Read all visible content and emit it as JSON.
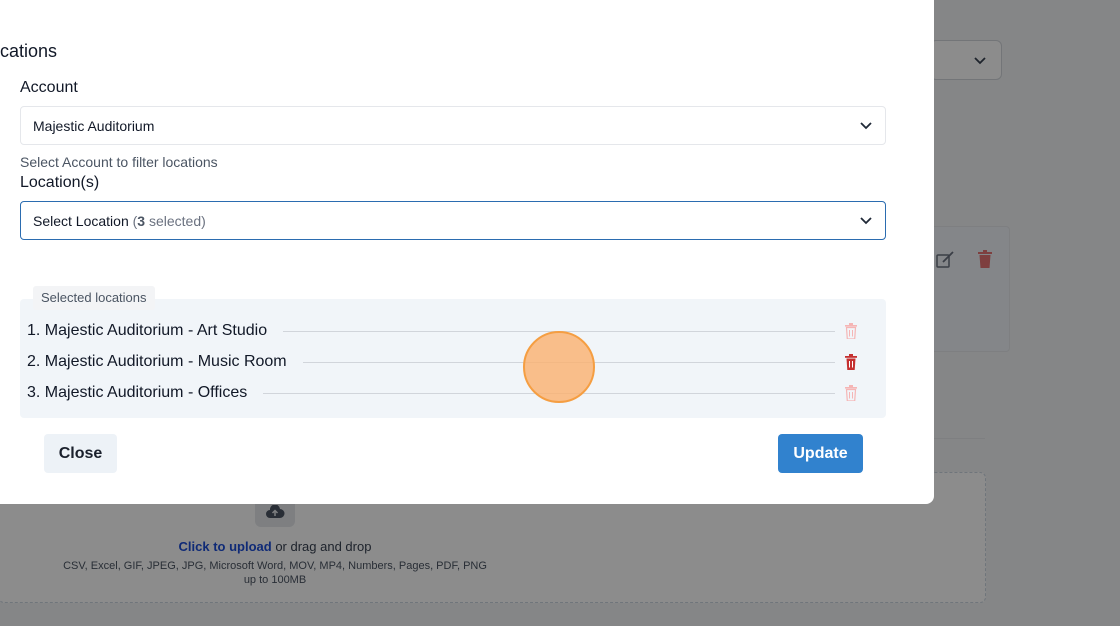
{
  "modal": {
    "title": "cations",
    "account": {
      "label": "Account",
      "value": "Majestic Auditorium",
      "help": "Select Account to filter locations"
    },
    "locations": {
      "label": "Location(s)",
      "placeholder": "Select Location",
      "count_open": "(",
      "count": "3",
      "count_close": " selected)"
    },
    "selected": {
      "legend": "Selected locations",
      "items": [
        {
          "label": "1. Majestic Auditorium - Art Studio"
        },
        {
          "label": "2. Majestic Auditorium - Music Room"
        },
        {
          "label": "3. Majestic Auditorium - Offices"
        }
      ]
    },
    "close_label": "Close",
    "update_label": "Update"
  },
  "background": {
    "upload": {
      "link": "Click to upload",
      "text": " or drag and drop",
      "formats": "CSV, Excel, GIF, JPEG, JPG, Microsoft Word, MOV, MP4, Numbers, Pages, PDF, PNG up to 100MB"
    }
  },
  "colors": {
    "accent": "#3182ce",
    "trash_inactive": "#f5b5b5",
    "trash_active": "#c53030",
    "click_marker": "#fbb06e"
  }
}
